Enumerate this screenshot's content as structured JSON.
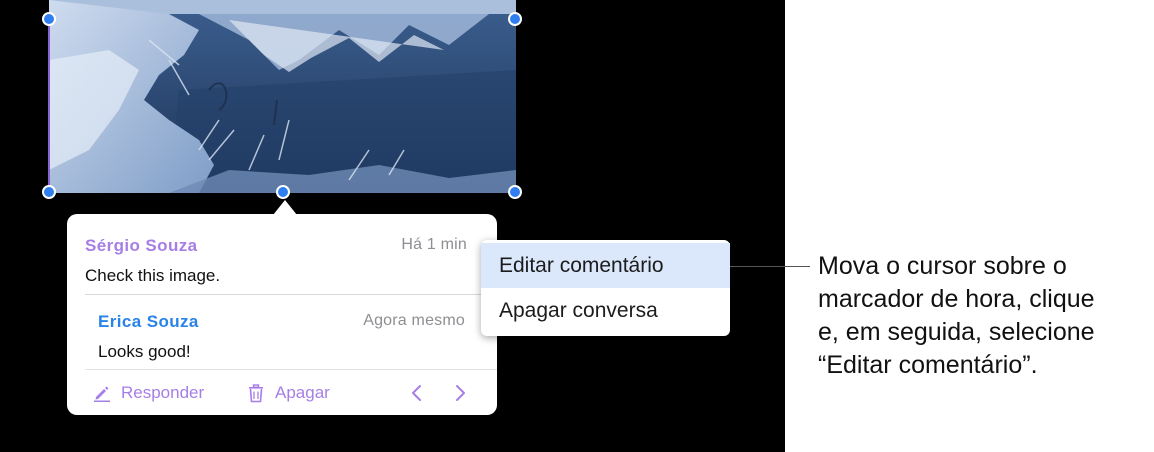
{
  "comments": [
    {
      "author": "Sérgio Souza",
      "time": "Há 1 min",
      "text": "Check this image."
    },
    {
      "author": "Erica Souza",
      "time": "Agora mesmo",
      "text": "Looks good!"
    }
  ],
  "footer": {
    "reply_label": "Responder",
    "delete_label": "Apagar",
    "prev_icon": "chevron-left-icon",
    "next_icon": "chevron-right-icon"
  },
  "menu": {
    "items": [
      "Editar comentário",
      "Apagar conversa"
    ]
  },
  "callout": {
    "lines": [
      "Mova o cursor sobre o",
      "marcador de hora, clique",
      "e, em seguida, selecione",
      "“Editar comentário”."
    ]
  },
  "colors": {
    "accent_purple": "#a77ee6",
    "accent_blue": "#2a83e8",
    "handle_blue": "#2f7ff0",
    "menu_highlight": "#dbe8fb"
  }
}
